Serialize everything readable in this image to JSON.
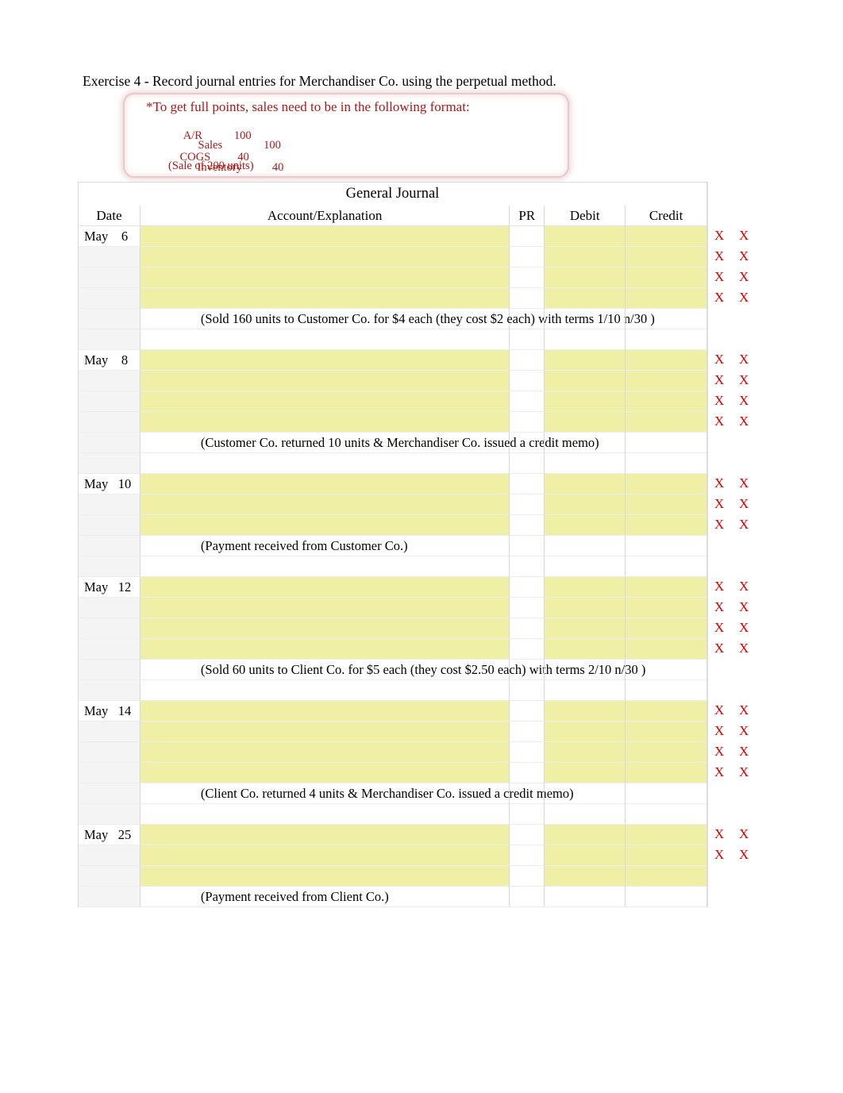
{
  "title": "Exercise 4 - Record journal entries for Merchandiser Co. using the perpetual method.",
  "instruction_box": {
    "accent_color": "#b11717",
    "border_color": "#e8c8c8",
    "heading": "*To get full points, sales need to be in the following format:",
    "lines": [
      {
        "account": "A/R",
        "amount": "100"
      },
      {
        "account": "Sales",
        "amount": "100"
      },
      {
        "account": "COGS",
        "amount": "40"
      },
      {
        "account": "Inventory",
        "amount": "40"
      },
      {
        "account": "(Sale of 200 units)",
        "amount": ""
      }
    ]
  },
  "journal": {
    "title": "General Journal",
    "headers": {
      "date": "Date",
      "account": "Account/Explanation",
      "pr": "PR",
      "debit": "Debit",
      "credit": "Credit"
    },
    "fill_color": "#efefa5",
    "mark_color": "#e00000",
    "mark_symbol": "X",
    "entries": [
      {
        "month": "May",
        "day": "6",
        "blank_rows": 4,
        "marked_rows": 4,
        "explanation": "(Sold 160 units to Customer Co. for $4 each (they cost $2 each) with terms 1/10 n/30 )"
      },
      {
        "month": "May",
        "day": "8",
        "blank_rows": 4,
        "marked_rows": 4,
        "explanation": "(Customer Co. returned 10 units & Merchandiser Co. issued a credit memo)"
      },
      {
        "month": "May",
        "day": "10",
        "blank_rows": 3,
        "marked_rows": 3,
        "explanation": "(Payment received from Customer Co.)"
      },
      {
        "month": "May",
        "day": "12",
        "blank_rows": 4,
        "marked_rows": 4,
        "explanation": "(Sold 60 units to Client Co. for $5 each (they cost $2.50 each) with terms 2/10 n/30 )"
      },
      {
        "month": "May",
        "day": "14",
        "blank_rows": 4,
        "marked_rows": 4,
        "explanation": "(Client Co. returned 4 units & Merchandiser Co. issued a credit memo)"
      },
      {
        "month": "May",
        "day": "25",
        "blank_rows": 3,
        "marked_rows": 2,
        "explanation": "(Payment received from Client Co.)"
      }
    ]
  }
}
